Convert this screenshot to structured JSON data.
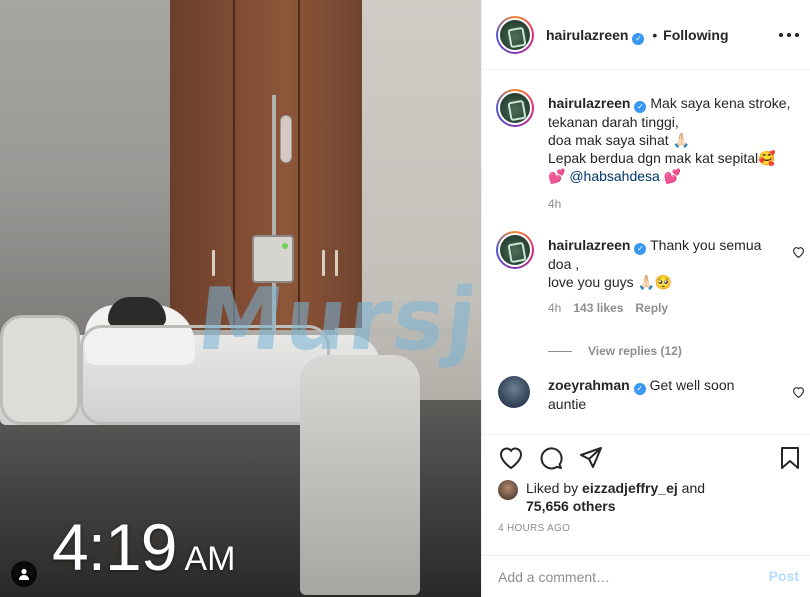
{
  "photo": {
    "time_digits": "4:19",
    "time_ampm": "AM",
    "watermark_text": "Mursj"
  },
  "header": {
    "username": "hairulazreen",
    "separator": "•",
    "follow_status": "Following"
  },
  "caption": {
    "username": "hairulazreen",
    "lines": [
      "Mak saya kena stroke,",
      "tekanan darah tinggi,",
      "doa mak saya sihat 🙏🏻",
      "Lepak berdua dgn mak kat sepital🥰",
      "💕 @habsahdesa 💕"
    ],
    "mention": "@habsahdesa",
    "age": "4h"
  },
  "comments": [
    {
      "username": "hairulazreen",
      "text_lines": [
        "Thank you semua",
        "doa ,",
        "love you guys 🙏🏻🥺"
      ],
      "age": "4h",
      "likes": "143 likes",
      "reply": "Reply",
      "view_replies": "View replies (12)"
    },
    {
      "username": "zoeyrahman",
      "text_lines": [
        "Get well soon",
        "auntie"
      ]
    }
  ],
  "actions": {
    "liked_by_prefix": "Liked by",
    "liked_by_user": "eizzadjeffry_ej",
    "liked_by_and": "and",
    "others": "75,656 others",
    "timestamp": "4 HOURS AGO"
  },
  "add_comment": {
    "placeholder": "Add a comment…",
    "post_label": "Post"
  },
  "icons": [
    "heart-icon",
    "comment-icon",
    "share-icon",
    "bookmark-icon",
    "more-icon",
    "verified-icon",
    "person-icon"
  ],
  "colors": {
    "verified": "#3897f0",
    "post_disabled": "#b3dbff",
    "muted": "#8e8e8e",
    "mention": "#00376b"
  }
}
